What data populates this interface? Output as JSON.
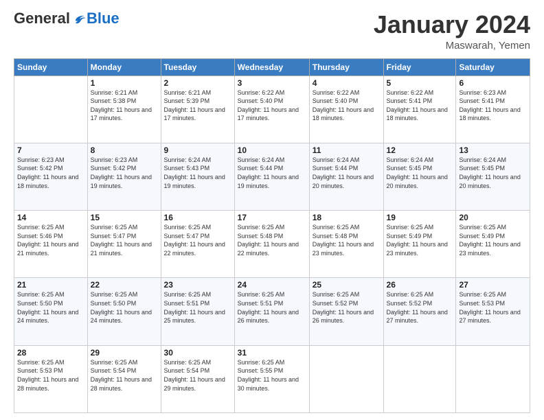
{
  "logo": {
    "general": "General",
    "blue": "Blue"
  },
  "header": {
    "month": "January 2024",
    "location": "Maswarah, Yemen"
  },
  "weekdays": [
    "Sunday",
    "Monday",
    "Tuesday",
    "Wednesday",
    "Thursday",
    "Friday",
    "Saturday"
  ],
  "weeks": [
    [
      {
        "day": "",
        "sunrise": "",
        "sunset": "",
        "daylight": ""
      },
      {
        "day": "1",
        "sunrise": "Sunrise: 6:21 AM",
        "sunset": "Sunset: 5:38 PM",
        "daylight": "Daylight: 11 hours and 17 minutes."
      },
      {
        "day": "2",
        "sunrise": "Sunrise: 6:21 AM",
        "sunset": "Sunset: 5:39 PM",
        "daylight": "Daylight: 11 hours and 17 minutes."
      },
      {
        "day": "3",
        "sunrise": "Sunrise: 6:22 AM",
        "sunset": "Sunset: 5:40 PM",
        "daylight": "Daylight: 11 hours and 17 minutes."
      },
      {
        "day": "4",
        "sunrise": "Sunrise: 6:22 AM",
        "sunset": "Sunset: 5:40 PM",
        "daylight": "Daylight: 11 hours and 18 minutes."
      },
      {
        "day": "5",
        "sunrise": "Sunrise: 6:22 AM",
        "sunset": "Sunset: 5:41 PM",
        "daylight": "Daylight: 11 hours and 18 minutes."
      },
      {
        "day": "6",
        "sunrise": "Sunrise: 6:23 AM",
        "sunset": "Sunset: 5:41 PM",
        "daylight": "Daylight: 11 hours and 18 minutes."
      }
    ],
    [
      {
        "day": "7",
        "sunrise": "Sunrise: 6:23 AM",
        "sunset": "Sunset: 5:42 PM",
        "daylight": "Daylight: 11 hours and 18 minutes."
      },
      {
        "day": "8",
        "sunrise": "Sunrise: 6:23 AM",
        "sunset": "Sunset: 5:42 PM",
        "daylight": "Daylight: 11 hours and 19 minutes."
      },
      {
        "day": "9",
        "sunrise": "Sunrise: 6:24 AM",
        "sunset": "Sunset: 5:43 PM",
        "daylight": "Daylight: 11 hours and 19 minutes."
      },
      {
        "day": "10",
        "sunrise": "Sunrise: 6:24 AM",
        "sunset": "Sunset: 5:44 PM",
        "daylight": "Daylight: 11 hours and 19 minutes."
      },
      {
        "day": "11",
        "sunrise": "Sunrise: 6:24 AM",
        "sunset": "Sunset: 5:44 PM",
        "daylight": "Daylight: 11 hours and 20 minutes."
      },
      {
        "day": "12",
        "sunrise": "Sunrise: 6:24 AM",
        "sunset": "Sunset: 5:45 PM",
        "daylight": "Daylight: 11 hours and 20 minutes."
      },
      {
        "day": "13",
        "sunrise": "Sunrise: 6:24 AM",
        "sunset": "Sunset: 5:45 PM",
        "daylight": "Daylight: 11 hours and 20 minutes."
      }
    ],
    [
      {
        "day": "14",
        "sunrise": "Sunrise: 6:25 AM",
        "sunset": "Sunset: 5:46 PM",
        "daylight": "Daylight: 11 hours and 21 minutes."
      },
      {
        "day": "15",
        "sunrise": "Sunrise: 6:25 AM",
        "sunset": "Sunset: 5:47 PM",
        "daylight": "Daylight: 11 hours and 21 minutes."
      },
      {
        "day": "16",
        "sunrise": "Sunrise: 6:25 AM",
        "sunset": "Sunset: 5:47 PM",
        "daylight": "Daylight: 11 hours and 22 minutes."
      },
      {
        "day": "17",
        "sunrise": "Sunrise: 6:25 AM",
        "sunset": "Sunset: 5:48 PM",
        "daylight": "Daylight: 11 hours and 22 minutes."
      },
      {
        "day": "18",
        "sunrise": "Sunrise: 6:25 AM",
        "sunset": "Sunset: 5:48 PM",
        "daylight": "Daylight: 11 hours and 23 minutes."
      },
      {
        "day": "19",
        "sunrise": "Sunrise: 6:25 AM",
        "sunset": "Sunset: 5:49 PM",
        "daylight": "Daylight: 11 hours and 23 minutes."
      },
      {
        "day": "20",
        "sunrise": "Sunrise: 6:25 AM",
        "sunset": "Sunset: 5:49 PM",
        "daylight": "Daylight: 11 hours and 23 minutes."
      }
    ],
    [
      {
        "day": "21",
        "sunrise": "Sunrise: 6:25 AM",
        "sunset": "Sunset: 5:50 PM",
        "daylight": "Daylight: 11 hours and 24 minutes."
      },
      {
        "day": "22",
        "sunrise": "Sunrise: 6:25 AM",
        "sunset": "Sunset: 5:50 PM",
        "daylight": "Daylight: 11 hours and 24 minutes."
      },
      {
        "day": "23",
        "sunrise": "Sunrise: 6:25 AM",
        "sunset": "Sunset: 5:51 PM",
        "daylight": "Daylight: 11 hours and 25 minutes."
      },
      {
        "day": "24",
        "sunrise": "Sunrise: 6:25 AM",
        "sunset": "Sunset: 5:51 PM",
        "daylight": "Daylight: 11 hours and 26 minutes."
      },
      {
        "day": "25",
        "sunrise": "Sunrise: 6:25 AM",
        "sunset": "Sunset: 5:52 PM",
        "daylight": "Daylight: 11 hours and 26 minutes."
      },
      {
        "day": "26",
        "sunrise": "Sunrise: 6:25 AM",
        "sunset": "Sunset: 5:52 PM",
        "daylight": "Daylight: 11 hours and 27 minutes."
      },
      {
        "day": "27",
        "sunrise": "Sunrise: 6:25 AM",
        "sunset": "Sunset: 5:53 PM",
        "daylight": "Daylight: 11 hours and 27 minutes."
      }
    ],
    [
      {
        "day": "28",
        "sunrise": "Sunrise: 6:25 AM",
        "sunset": "Sunset: 5:53 PM",
        "daylight": "Daylight: 11 hours and 28 minutes."
      },
      {
        "day": "29",
        "sunrise": "Sunrise: 6:25 AM",
        "sunset": "Sunset: 5:54 PM",
        "daylight": "Daylight: 11 hours and 28 minutes."
      },
      {
        "day": "30",
        "sunrise": "Sunrise: 6:25 AM",
        "sunset": "Sunset: 5:54 PM",
        "daylight": "Daylight: 11 hours and 29 minutes."
      },
      {
        "day": "31",
        "sunrise": "Sunrise: 6:25 AM",
        "sunset": "Sunset: 5:55 PM",
        "daylight": "Daylight: 11 hours and 30 minutes."
      },
      {
        "day": "",
        "sunrise": "",
        "sunset": "",
        "daylight": ""
      },
      {
        "day": "",
        "sunrise": "",
        "sunset": "",
        "daylight": ""
      },
      {
        "day": "",
        "sunrise": "",
        "sunset": "",
        "daylight": ""
      }
    ]
  ]
}
